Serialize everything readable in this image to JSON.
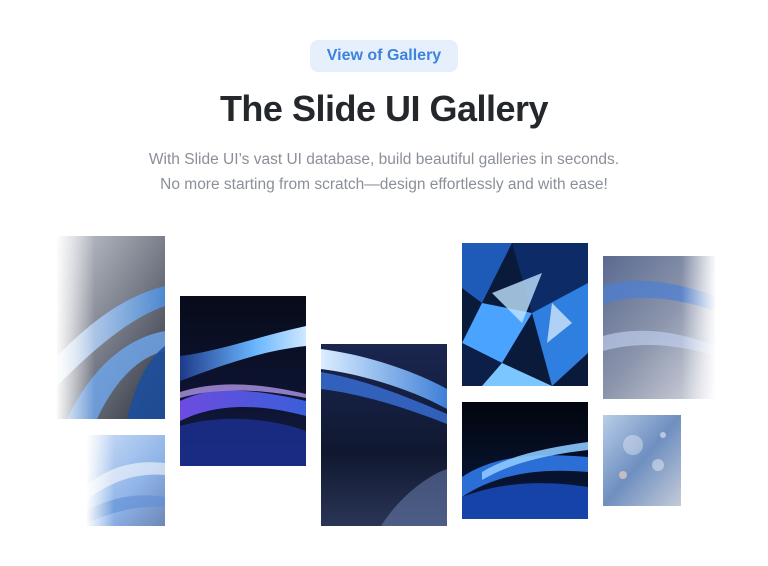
{
  "header": {
    "badge_label": "View of Gallery",
    "title": "The Slide UI Gallery",
    "subtitle_line1": "With Slide UI’s vast UI database, build beautiful galleries in seconds.",
    "subtitle_line2": "No more starting from scratch—design effortlessly and with ease!"
  },
  "colors": {
    "accent": "#3d82db",
    "badge_bg": "#e6f0fc",
    "title": "#24272c",
    "subtitle": "#8a8f98"
  },
  "gallery": {
    "images": [
      "abstract-blue-wave-image",
      "abstract-blue-wave-image",
      "abstract-blue-wave-image",
      "abstract-blue-wave-image",
      "abstract-blue-crystal-image",
      "abstract-blue-wave-image",
      "abstract-blue-wave-image",
      "abstract-blue-bokeh-image"
    ]
  }
}
